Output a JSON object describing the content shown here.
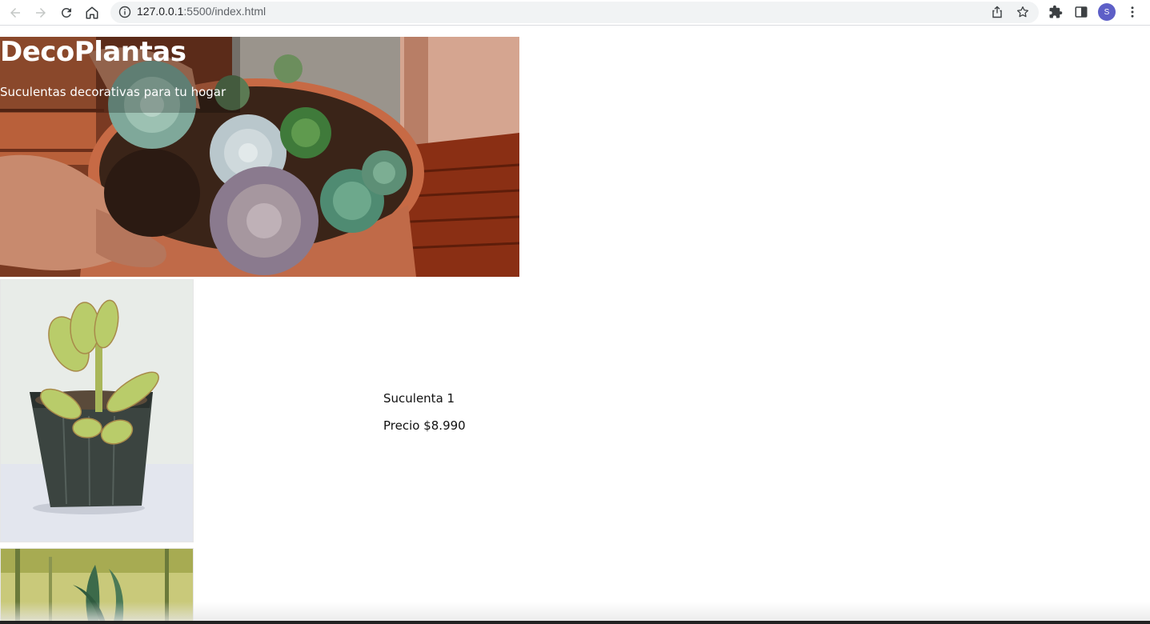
{
  "browser": {
    "url_host": "127.0.0.1",
    "url_rest": ":5500/index.html",
    "profile_initial": "S"
  },
  "hero": {
    "title": "DecoPlantas",
    "subtitle": "Suculentas decorativas para tu hogar"
  },
  "products": [
    {
      "name": "Suculenta 1",
      "price": "Precio $8.990"
    }
  ],
  "colors": {
    "accent_avatar": "#5d5fc7",
    "hero_text": "#ffffff",
    "omnibox": "#f1f3f4"
  }
}
